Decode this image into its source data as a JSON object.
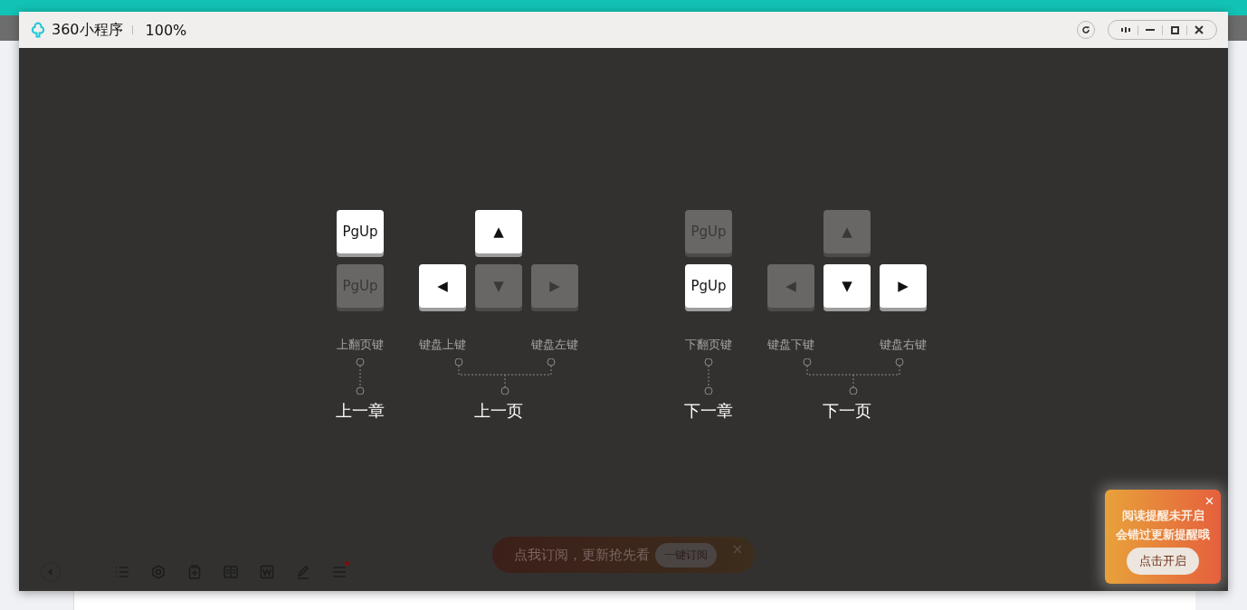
{
  "window": {
    "title": "360小程序",
    "zoom": "100%"
  },
  "sides": [
    {
      "actions": [
        {
          "kind": "pg",
          "keys": [
            {
              "label": "PgUp",
              "active": true
            },
            {
              "label": "PgUp",
              "active": false
            }
          ],
          "captions": [
            "上翻页键"
          ],
          "title": "上一章"
        },
        {
          "kind": "arrows",
          "keys": [
            {
              "label": "▲",
              "active": true
            },
            {
              "label": "◀",
              "active": true
            },
            {
              "label": "▼",
              "active": false
            },
            {
              "label": "▶",
              "active": false
            }
          ],
          "captions": [
            "键盘上键",
            "键盘左键"
          ],
          "title": "上一页"
        }
      ]
    },
    {
      "actions": [
        {
          "kind": "pg",
          "keys": [
            {
              "label": "PgUp",
              "active": false
            },
            {
              "label": "PgUp",
              "active": true
            }
          ],
          "captions": [
            "下翻页键"
          ],
          "title": "下一章"
        },
        {
          "kind": "arrows",
          "keys": [
            {
              "label": "▲",
              "active": false
            },
            {
              "label": "◀",
              "active": false
            },
            {
              "label": "▼",
              "active": true
            },
            {
              "label": "▶",
              "active": true
            }
          ],
          "captions": [
            "键盘下键",
            "键盘右键"
          ],
          "title": "下一页"
        }
      ]
    }
  ],
  "toolbar": {
    "tools": [
      {
        "kind": "list",
        "badge": false
      },
      {
        "kind": "settings",
        "badge": false
      },
      {
        "kind": "bookmark",
        "badge": false
      },
      {
        "kind": "book",
        "badge": false
      },
      {
        "kind": "word",
        "badge": false
      },
      {
        "kind": "pen",
        "badge": false
      },
      {
        "kind": "layers",
        "badge": true
      }
    ]
  },
  "subscribe": {
    "text": "点我订阅，更新抢先看",
    "button": "一键订阅"
  },
  "reminder": {
    "lines": [
      "阅读提醒未开启",
      "会错过更新提醒哦"
    ],
    "button": "点击开启"
  }
}
